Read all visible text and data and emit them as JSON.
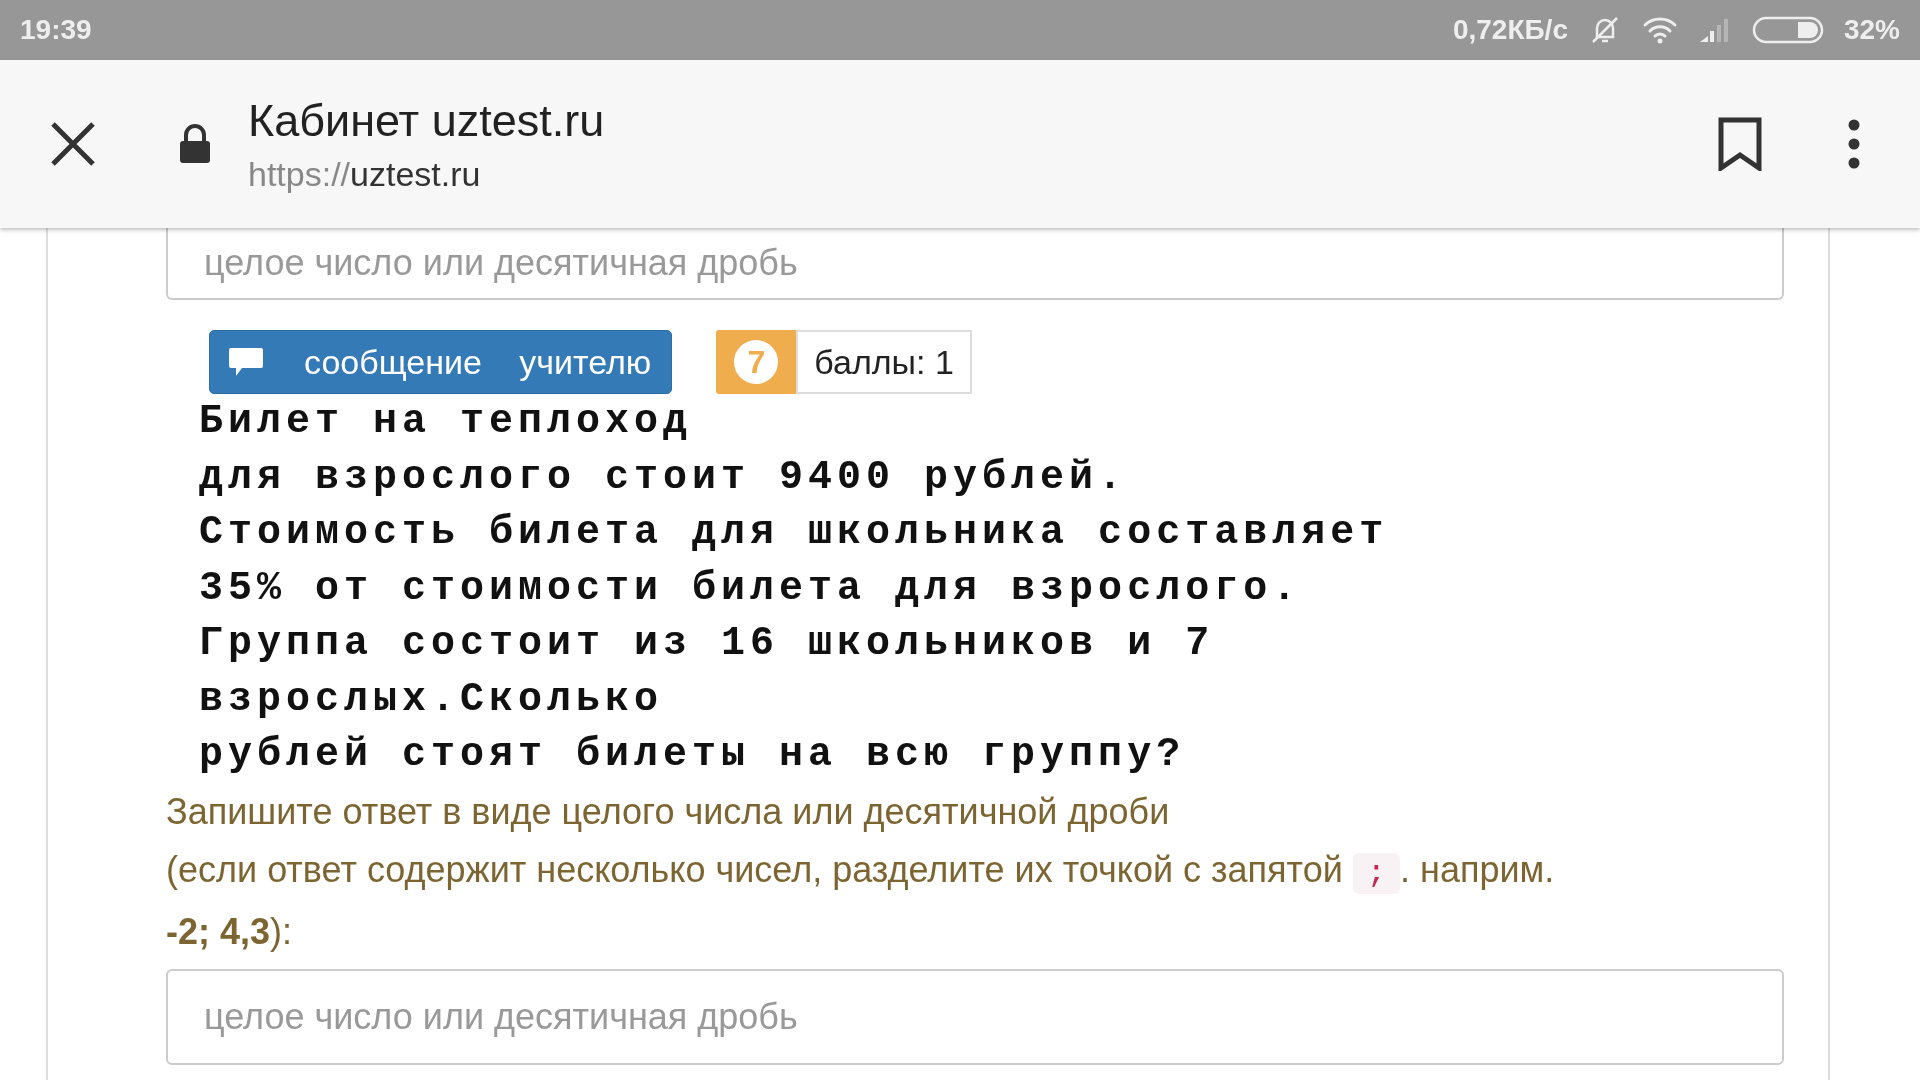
{
  "status_bar": {
    "time": "19:39",
    "speed": "0,72КБ/с",
    "battery": "32%"
  },
  "browser": {
    "title": "Кабинет uztest.ru",
    "url_scheme": "https://",
    "url_host": "uztest.ru"
  },
  "top_field": {
    "placeholder": "целое число или десятичная дробь"
  },
  "message_button": {
    "label": "сообщение учителю"
  },
  "score": {
    "number": "7",
    "label": "баллы: 1"
  },
  "problem_lines": [
    "Билет на теплоход",
    "для взрослого стоит 9400 рублей.",
    "Стоимость билета для школьника составляет",
    "35% от стоимости билета для взрослого.",
    "Группа состоит из 16 школьников и 7",
    "взрослых.Сколько",
    "рублей стоят билеты на всю группу?"
  ],
  "instruction": {
    "text_before": "Запишите ответ в виде целого числа или десятичной дроби\n(если ответ содержит несколько чисел, разделите их точкой с запятой",
    "code": ";",
    "text_after": ". наприм.\n**-2; 4,3**):"
  },
  "answer_field": {
    "placeholder": "целое число или десятичная дробь"
  }
}
